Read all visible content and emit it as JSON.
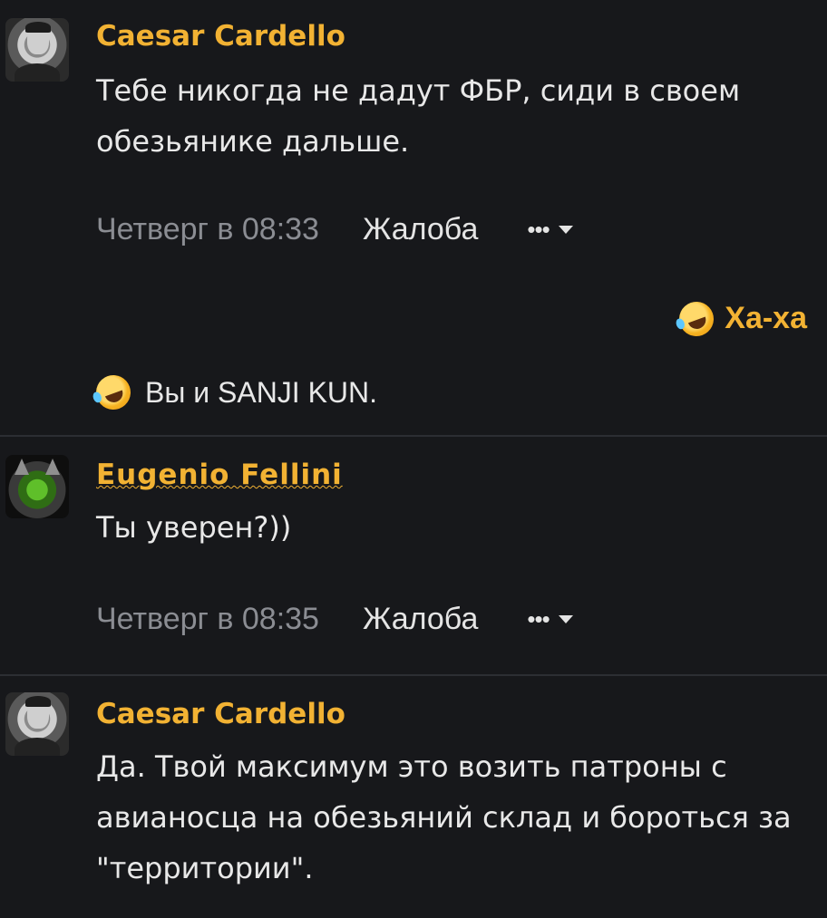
{
  "posts": [
    {
      "author": "Caesar Cardello",
      "text": "Тебе никогда не дадут ФБР, сиди в своем обезьянике дальше.",
      "time": "Четверг в 08:33",
      "report_label": "Жалоба",
      "more_label": "•••",
      "reaction_button_label": "Ха-ха",
      "reactions_summary": "Вы и SANJI KUN."
    },
    {
      "author": "Eugenio Fellini",
      "text": "Ты уверен?))",
      "time": "Четверг в 08:35",
      "report_label": "Жалоба",
      "more_label": "•••"
    },
    {
      "author": "Caesar Cardello",
      "text": "Да. Твой максимум это возить патроны с авианосца на обезьяний склад и бороться за \"территории\"."
    }
  ],
  "colors": {
    "background": "#17181b",
    "username": "#f2b233",
    "meta_time": "#8b8d93",
    "text": "#e8e8e8",
    "divider": "#2c2e33"
  },
  "icons": {
    "reaction": "rolling-on-floor-laughing-emoji",
    "more_menu": "ellipsis-caret-icon"
  }
}
